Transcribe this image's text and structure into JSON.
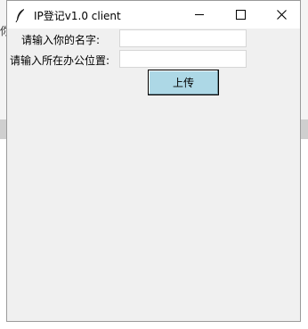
{
  "window": {
    "title": "IP登记v1.0 client",
    "icon": "feather-icon",
    "controls": {
      "minimize_icon": "minimize-icon",
      "maximize_icon": "maximize-icon",
      "close_icon": "close-icon",
      "close_glyph": "✕"
    }
  },
  "background": {
    "partial_glyph": "你"
  },
  "form": {
    "name_label": "请输入你的名字:",
    "name_value": "",
    "office_label": "请输入所在办公位置:",
    "office_value": "",
    "upload_label": "上传",
    "upload_color": "#add8e6"
  }
}
